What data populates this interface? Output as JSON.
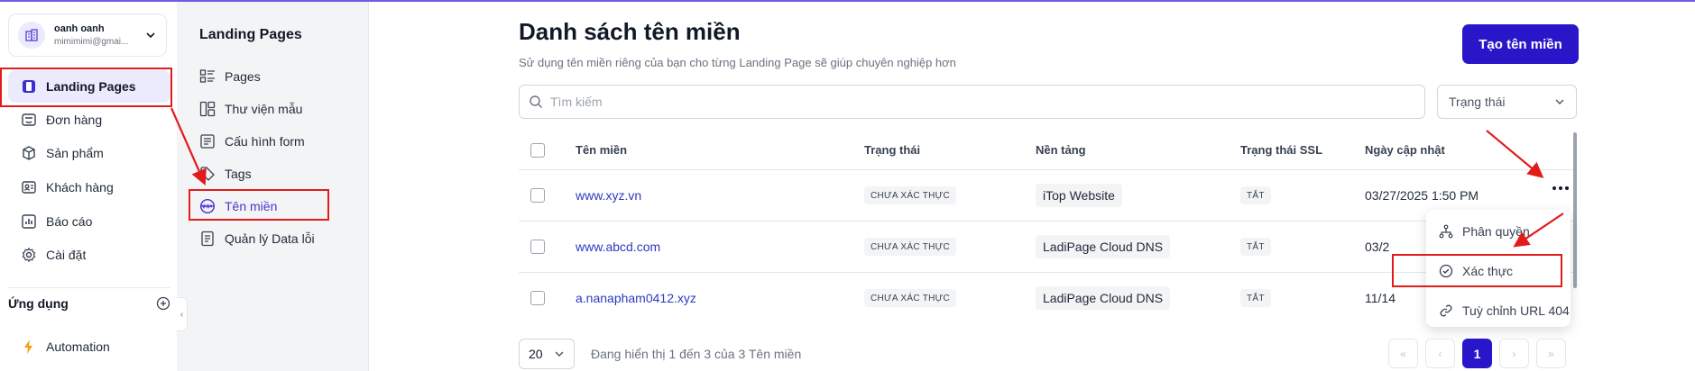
{
  "account": {
    "name": "oanh oanh",
    "email": "mimimimi@gmai..."
  },
  "nav": {
    "items": [
      {
        "label": "Landing Pages",
        "icon": "landing-pages-icon"
      },
      {
        "label": "Đơn hàng",
        "icon": "order-icon"
      },
      {
        "label": "Sản phẩm",
        "icon": "product-box-icon"
      },
      {
        "label": "Khách hàng",
        "icon": "customer-card-icon"
      },
      {
        "label": "Báo cáo",
        "icon": "report-chart-icon"
      },
      {
        "label": "Cài đặt",
        "icon": "gear-icon"
      }
    ],
    "apps_title": "Ứng dụng",
    "automation_label": "Automation"
  },
  "submenu": {
    "title": "Landing Pages",
    "items": [
      {
        "label": "Pages",
        "icon": "pages-list-icon"
      },
      {
        "label": "Thư viện mẫu",
        "icon": "template-library-icon"
      },
      {
        "label": "Cấu hình form",
        "icon": "form-config-icon"
      },
      {
        "label": "Tags",
        "icon": "tag-icon"
      },
      {
        "label": "Tên miền",
        "icon": "www-globe-icon"
      },
      {
        "label": "Quản lý Data lỗi",
        "icon": "error-data-icon"
      }
    ]
  },
  "main": {
    "title": "Danh sách tên miền",
    "subtitle": "Sử dụng tên miền riêng của bạn cho từng Landing Page sẽ giúp chuyên nghiệp hơn",
    "create_button": "Tạo tên miền",
    "search_placeholder": "Tìm kiếm",
    "status_filter": "Trạng thái",
    "columns": [
      "Tên miền",
      "Trạng thái",
      "Nền tảng",
      "Trạng thái SSL",
      "Ngày cập nhật"
    ],
    "rows": [
      {
        "domain": "www.xyz.vn",
        "status": "CHƯA XÁC THỰC",
        "platform": "iTop Website",
        "ssl": "TẮT",
        "updated": "03/27/2025 1:50 PM"
      },
      {
        "domain": "www.abcd.com",
        "status": "CHƯA XÁC THỰC",
        "platform": "LadiPage Cloud DNS",
        "ssl": "TẮT",
        "updated": "03/2"
      },
      {
        "domain": "a.nanapham0412.xyz",
        "status": "CHƯA XÁC THỰC",
        "platform": "LadiPage Cloud DNS",
        "ssl": "TẮT",
        "updated": "11/14"
      }
    ],
    "row_menu": [
      {
        "label": "Phân quyền",
        "icon": "permission-tree-icon"
      },
      {
        "label": "Xác thực",
        "icon": "check-circle-icon"
      },
      {
        "label": "Tuỳ chỉnh URL 404",
        "icon": "link-icon"
      }
    ],
    "pagination": {
      "page_size": "20",
      "showing": "Đang hiển thị 1 đến 3 của 3 Tên miền",
      "current_page": "1",
      "first": "«",
      "prev": "‹",
      "next": "›",
      "last": "»"
    }
  },
  "colors": {
    "accent": "#2a16c9",
    "annotation": "#e21b1b",
    "link": "#2b3bbf"
  }
}
